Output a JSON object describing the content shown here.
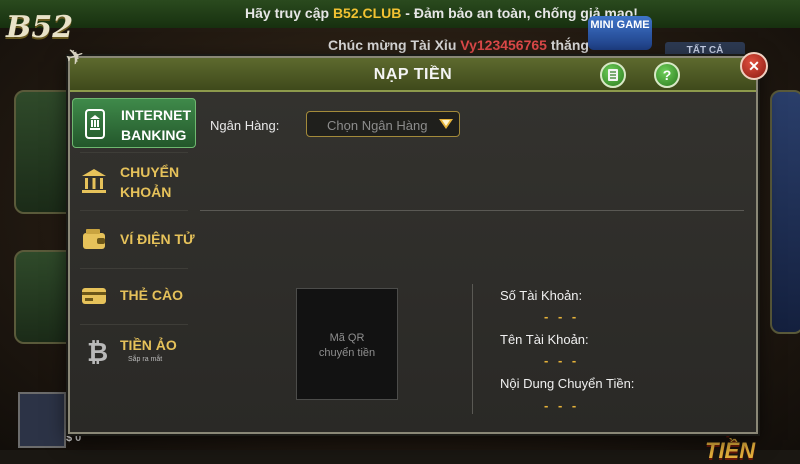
{
  "top_notice": {
    "prefix": "Hãy truy cập ",
    "site": "B52.CLUB",
    "suffix": " - Đảm bảo an toàn, chống giả mạo!"
  },
  "congrats": {
    "prefix": "Chúc mừng Tài Xỉu ",
    "user": "Vy123456765",
    "suffix": " thắng"
  },
  "logo": "B52",
  "minigame_label": "MINI GAME",
  "all_tab_label": "TẤT CẢ",
  "modal": {
    "title": "NẠP TIỀN",
    "history_icon": "document-icon",
    "help_label": "?",
    "close_label": "✕"
  },
  "sidebar": {
    "items": [
      {
        "line1": "INTERNET",
        "line2": "BANKING",
        "icon": "bank-phone-icon",
        "active": true
      },
      {
        "line1": "CHUYỂN",
        "line2": "KHOẢN",
        "icon": "bank-building-icon",
        "active": false
      },
      {
        "line1": "VÍ ĐIỆN TỬ",
        "line2": "",
        "icon": "wallet-icon",
        "active": false
      },
      {
        "line1": "THẺ CÀO",
        "line2": "",
        "icon": "card-icon",
        "active": false
      },
      {
        "line1": "TIỀN ẢO",
        "line2": "",
        "sub": "Sắp ra mắt",
        "icon": "bitcoin-icon",
        "active": false
      }
    ]
  },
  "content": {
    "bank_label": "Ngân Hàng:",
    "bank_placeholder": "Chọn Ngân Hàng",
    "qr_line1": "Mã QR",
    "qr_line2": "chuyển tiền",
    "account_number_label": "Số Tài Khoản:",
    "account_number_value": "- - -",
    "account_name_label": "Tên Tài Khoản:",
    "account_name_value": "- - -",
    "transfer_content_label": "Nội Dung Chuyển Tiền:",
    "transfer_content_value": "- - -"
  },
  "background": {
    "balance_label": "$ 0",
    "deposit_button": "NẠP TIỀN"
  },
  "colors": {
    "accent_gold": "#e6c25a",
    "active_green": "#3f8a4a",
    "header_olive": "#5d6a2e"
  }
}
